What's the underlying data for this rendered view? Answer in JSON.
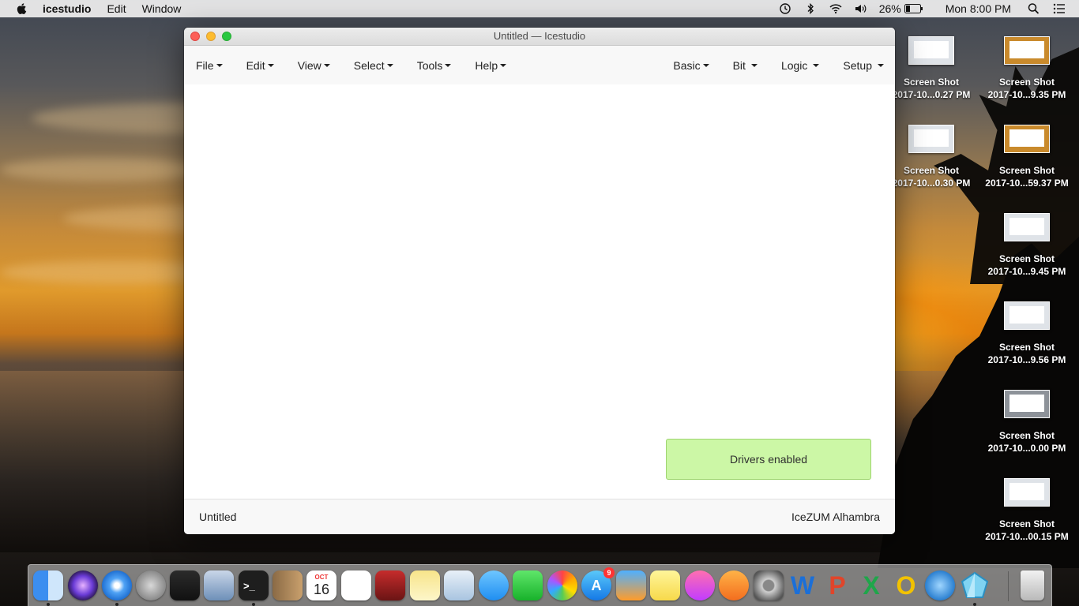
{
  "menubar": {
    "app_name": "icestudio",
    "items": [
      "Edit",
      "Window"
    ],
    "battery": "26%",
    "clock": "Mon 8:00 PM"
  },
  "desktop_icons": [
    {
      "line1": "Screen Shot",
      "line2": "2017-10...0.27 PM"
    },
    {
      "line1": "Screen Shot",
      "line2": "2017-10...9.35 PM"
    },
    {
      "line1": "Screen Shot",
      "line2": "2017-10...0.30 PM"
    },
    {
      "line1": "Screen Shot",
      "line2": "2017-10...59.37 PM"
    },
    {
      "line1": "Screen Shot",
      "line2": "2017-10...9.45 PM"
    },
    {
      "line1": "Screen Shot",
      "line2": "2017-10...9.56 PM"
    },
    {
      "line1": "Screen Shot",
      "line2": "2017-10...0.00 PM"
    },
    {
      "line1": "Screen Shot",
      "line2": "2017-10...00.15 PM"
    }
  ],
  "window": {
    "title": "Untitled — Icestudio",
    "menu_left": [
      "File",
      "Edit",
      "View",
      "Select",
      "Tools",
      "Help"
    ],
    "menu_right": [
      "Basic",
      "Bit",
      "Logic",
      "Setup"
    ],
    "notification": "Drivers enabled",
    "footer_left": "Untitled",
    "footer_right": "IceZUM Alhambra"
  },
  "dock": {
    "calendar_month": "OCT",
    "calendar_day": "16",
    "appstore_badge": "9",
    "apps": [
      "finder-icon",
      "siri-icon",
      "safari-icon",
      "launchpad-icon",
      "photo-booth-icon",
      "mail-icon",
      "terminal-icon",
      "contacts-icon",
      "calendar-icon",
      "reminders-icon",
      "photo-grid-icon",
      "notes-icon",
      "preview-icon",
      "messages-icon",
      "facetime-icon",
      "photos-icon",
      "app-store-icon",
      "game-icon",
      "stickies-icon",
      "itunes-icon",
      "ibooks-icon",
      "system-preferences-icon",
      "word-icon",
      "powerpoint-icon",
      "excel-icon",
      "outlook-icon",
      "downloader-icon",
      "icestudio-icon",
      "trash-icon"
    ]
  }
}
